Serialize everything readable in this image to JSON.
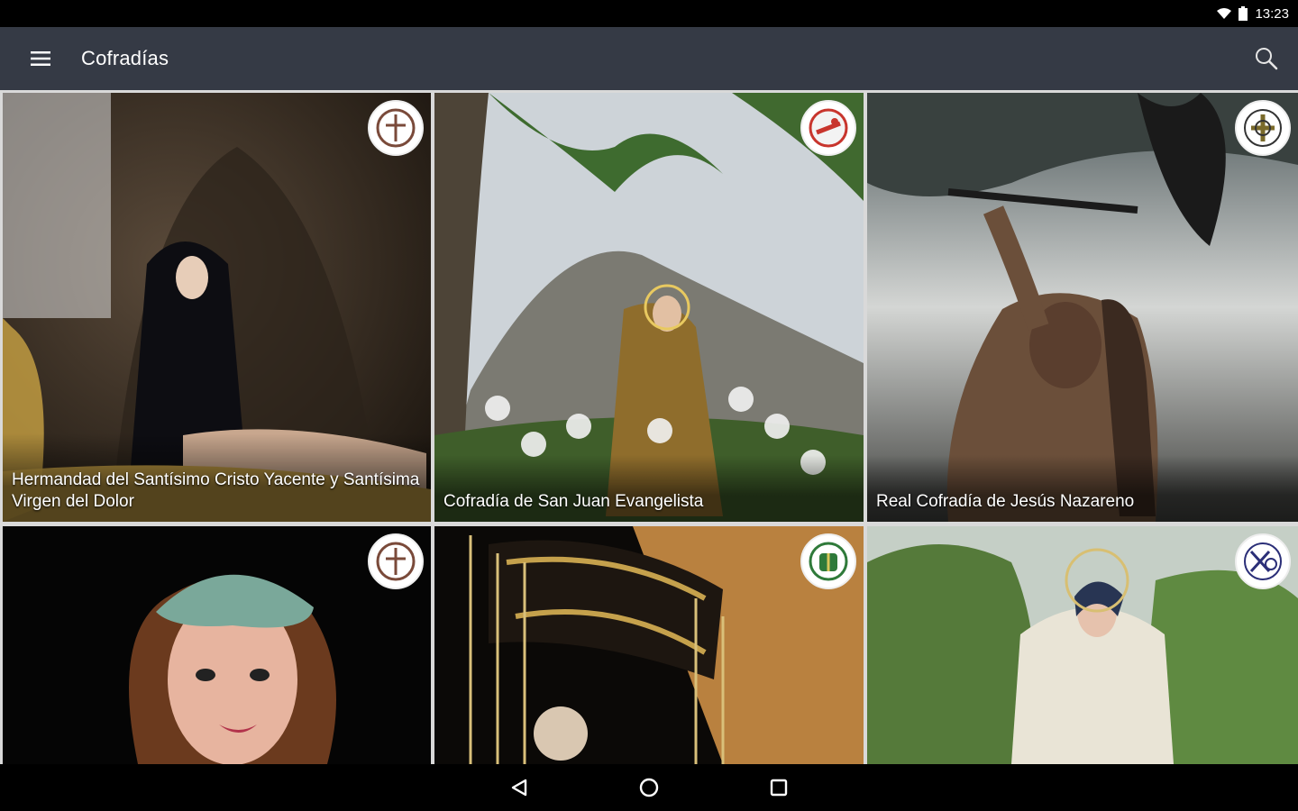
{
  "status_bar": {
    "time": "13:23"
  },
  "app_bar": {
    "title": "Cofradías"
  },
  "cofradias": [
    {
      "name": "Hermandad del Santísimo Cristo Yacente y Santísima Virgen del Dolor"
    },
    {
      "name": "Cofradía de San Juan Evangelista"
    },
    {
      "name": "Real Cofradía de Jesús Nazareno"
    },
    {
      "name": ""
    },
    {
      "name": ""
    },
    {
      "name": ""
    }
  ],
  "colors": {
    "app_bar": "#353a45",
    "status_bar": "#000000",
    "nav_bar": "#000000",
    "grid_gap": "#d9d9d9"
  },
  "icons": {
    "menu": "menu-icon",
    "search": "search-icon",
    "back": "back-icon",
    "home": "home-icon",
    "recents": "recents-icon",
    "wifi": "wifi-icon",
    "battery": "battery-icon"
  }
}
